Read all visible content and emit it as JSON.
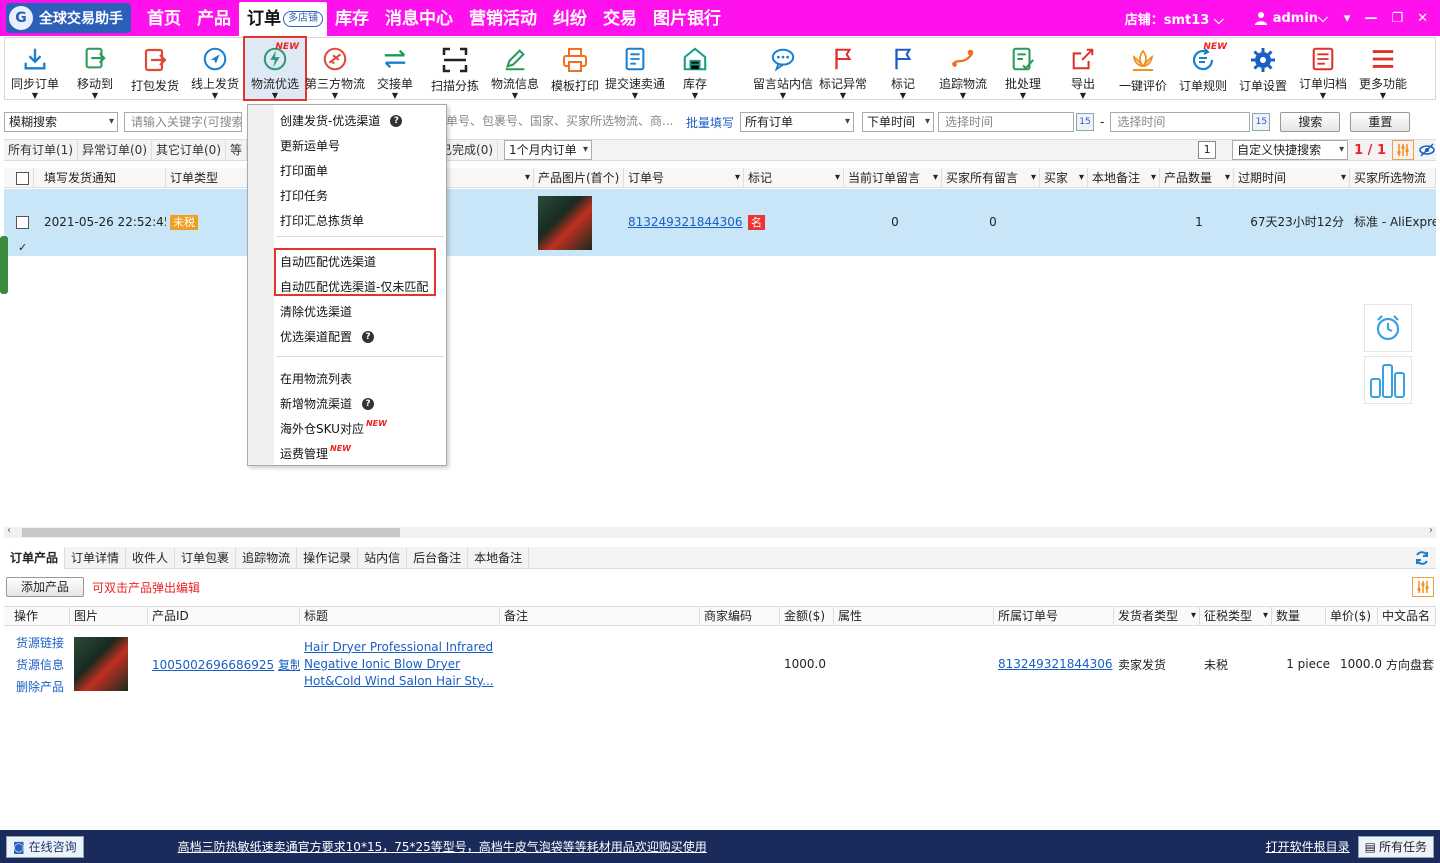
{
  "app": {
    "title": "全球交易助手"
  },
  "topnav": [
    {
      "label": "首页"
    },
    {
      "label": "产品"
    },
    {
      "label": "订单",
      "badge": "多店铺"
    },
    {
      "label": "库存"
    },
    {
      "label": "消息中心"
    },
    {
      "label": "营销活动"
    },
    {
      "label": "纠纷"
    },
    {
      "label": "交易"
    },
    {
      "label": "图片银行"
    }
  ],
  "header": {
    "store": "店铺：smt13",
    "user": "admin"
  },
  "toolbar": [
    {
      "label": "同步订单",
      "icon": "download-icon"
    },
    {
      "label": "移动到",
      "icon": "move-icon"
    },
    {
      "label": "打包发货",
      "icon": "pack-ship-icon"
    },
    {
      "label": "线上发货",
      "icon": "online-ship-icon"
    },
    {
      "label": "物流优选",
      "icon": "lightning-icon",
      "new": "NEW"
    },
    {
      "label": "第三方物流",
      "icon": "plane-icon"
    },
    {
      "label": "交接单",
      "icon": "exchange-icon"
    },
    {
      "label": "扫描分拣",
      "icon": "scan-icon"
    },
    {
      "label": "物流信息",
      "icon": "edit-icon"
    },
    {
      "label": "模板打印",
      "icon": "printer-icon"
    },
    {
      "label": "提交速卖通",
      "icon": "document-icon"
    },
    {
      "label": "库存",
      "icon": "warehouse-icon"
    },
    {
      "label": "留言站内信",
      "icon": "chat-icon"
    },
    {
      "label": "标记异常",
      "icon": "red-flag-icon"
    },
    {
      "label": "标记",
      "icon": "blue-flag-icon"
    },
    {
      "label": "追踪物流",
      "icon": "tracking-icon"
    },
    {
      "label": "批处理",
      "icon": "batch-icon"
    },
    {
      "label": "导出",
      "icon": "export-icon"
    },
    {
      "label": "一键评价",
      "icon": "lotus-icon"
    },
    {
      "label": "订单规则",
      "icon": "rules-icon",
      "new": "NEW"
    },
    {
      "label": "订单设置",
      "icon": "gear-icon"
    },
    {
      "label": "订单归档",
      "icon": "archive-icon"
    },
    {
      "label": "更多功能",
      "icon": "menu-icon"
    }
  ],
  "filters": {
    "fuzzy": "模糊搜索",
    "keyword_placeholder": "请输入关键字(可搜索",
    "keyword_hint": "单号、包裹号、国家、买家所选物流、商...",
    "batch_fill": "批量填写",
    "all_orders": "所有订单",
    "order_time": "下单时间",
    "start_time": "选择时间",
    "end_time": "选择时间",
    "dash": "-",
    "cal_label": "15",
    "search": "搜索",
    "reset": "重置"
  },
  "status_tabs": [
    {
      "label": "所有订单(1)"
    },
    {
      "label": "异常订单(0)"
    },
    {
      "label": "其它订单(0)"
    },
    {
      "label": "等"
    }
  ],
  "status_extra": {
    "completed": "已完成(0)",
    "period": "1个月内订单",
    "page_box": "1",
    "quick_search": "自定义快捷搜索",
    "page_count": "1 / 1"
  },
  "grid_columns": [
    {
      "label": "填写发货通知"
    },
    {
      "label": "订单类型"
    },
    {
      "label": ""
    },
    {
      "label": "产品图片(首个)"
    },
    {
      "label": "订单号"
    },
    {
      "label": "标记"
    },
    {
      "label": "当前订单留言"
    },
    {
      "label": "买家所有留言"
    },
    {
      "label": "买家"
    },
    {
      "label": "本地备注"
    },
    {
      "label": "产品数量"
    },
    {
      "label": "过期时间"
    },
    {
      "label": "买家所选物流"
    }
  ],
  "order_row": {
    "notice_time": "2021-05-26 22:52:45",
    "type": "未税",
    "order_no": "813249321844306",
    "mark": "名",
    "current_msg": "0",
    "buyer_msgs": "0",
    "quantity": "1",
    "expire": "67天23小时12分",
    "shipping": "标准 - AliExpre"
  },
  "dropdown": {
    "items": [
      {
        "label": "创建发货-优选渠道",
        "help": "?"
      },
      {
        "label": "更新运单号"
      },
      {
        "label": "打印面单"
      },
      {
        "label": "打印任务"
      },
      {
        "label": "打印汇总拣货单"
      },
      {
        "label": "自动匹配优选渠道"
      },
      {
        "label": "自动匹配优选渠道-仅未匹配"
      },
      {
        "label": "清除优选渠道"
      },
      {
        "label": "优选渠道配置",
        "help": "?"
      },
      {
        "label": "在用物流列表"
      },
      {
        "label": "新增物流渠道",
        "help": "?"
      },
      {
        "label": "海外仓SKU对应",
        "new": "NEW"
      },
      {
        "label": "运费管理",
        "new": "NEW"
      }
    ]
  },
  "bottom_tabs": [
    {
      "label": "订单产品"
    },
    {
      "label": "订单详情"
    },
    {
      "label": "收件人"
    },
    {
      "label": "订单包裹"
    },
    {
      "label": "追踪物流"
    },
    {
      "label": "操作记录"
    },
    {
      "label": "站内信"
    },
    {
      "label": "后台备注"
    },
    {
      "label": "本地备注"
    }
  ],
  "subbar": {
    "add_product": "添加产品",
    "hint": "可双击产品弹出编辑"
  },
  "product_columns": [
    {
      "label": "操作"
    },
    {
      "label": "图片"
    },
    {
      "label": "产品ID"
    },
    {
      "label": "标题"
    },
    {
      "label": "备注"
    },
    {
      "label": "商家编码"
    },
    {
      "label": "金额($)"
    },
    {
      "label": "属性"
    },
    {
      "label": "所属订单号"
    },
    {
      "label": "发货者类型"
    },
    {
      "label": "征税类型"
    },
    {
      "label": "数量"
    },
    {
      "label": "单价($)"
    },
    {
      "label": "中文品名"
    }
  ],
  "product_row": {
    "links": [
      "货源链接",
      "货源信息",
      "删除产品"
    ],
    "product_id": "1005002696686925",
    "copy": "复制",
    "title_lines": [
      "Hair Dryer Professional Infrared",
      "Negative Ionic Blow Dryer",
      "Hot&Cold Wind Salon Hair Sty..."
    ],
    "amount": "1000.0",
    "order_no": "813249321844306",
    "shipper": "卖家发货",
    "tax": "未税",
    "qty": "1 piece",
    "unit_price": "1000.0",
    "cn_name": "方向盘套"
  },
  "footer": {
    "online": "在线咨询",
    "marquee": "高档三防热敏纸速卖通官方要求10*15，75*25等型号，高档牛皮气泡袋等等耗材用品欢迎购买使用",
    "open_dir": "打开软件根目录",
    "all_tasks": "所有任务"
  },
  "colors": {
    "titlebar": "#ff11ee",
    "highlight": "#e8322c",
    "link": "#1a5fc4",
    "row_selected": "#c8e6f8",
    "footer": "#1a2a5a"
  }
}
